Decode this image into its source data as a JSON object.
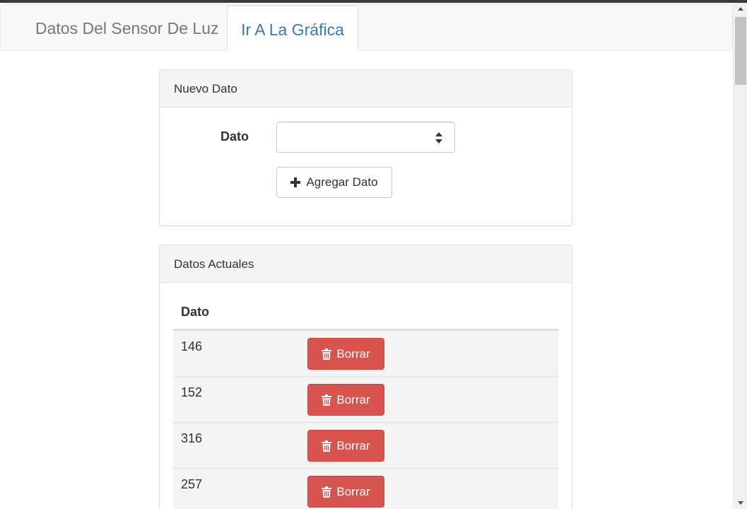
{
  "navbar": {
    "brand": "Datos Del Sensor De Luz",
    "tab_chart": "Ir A La Gráfica"
  },
  "new_data_panel": {
    "heading": "Nuevo Dato",
    "field_label": "Dato",
    "input_value": "",
    "add_button_label": "Agregar Dato",
    "add_icon": "plus-icon"
  },
  "current_data_panel": {
    "heading": "Datos Actuales",
    "column_header": "Dato",
    "delete_label": "Borrar",
    "delete_icon": "trash-icon",
    "rows": [
      {
        "value": "146"
      },
      {
        "value": "152"
      },
      {
        "value": "316"
      },
      {
        "value": "257"
      }
    ]
  },
  "colors": {
    "link": "#337ab7",
    "danger": "#d9534f",
    "panel_heading_bg": "#f5f5f5"
  }
}
